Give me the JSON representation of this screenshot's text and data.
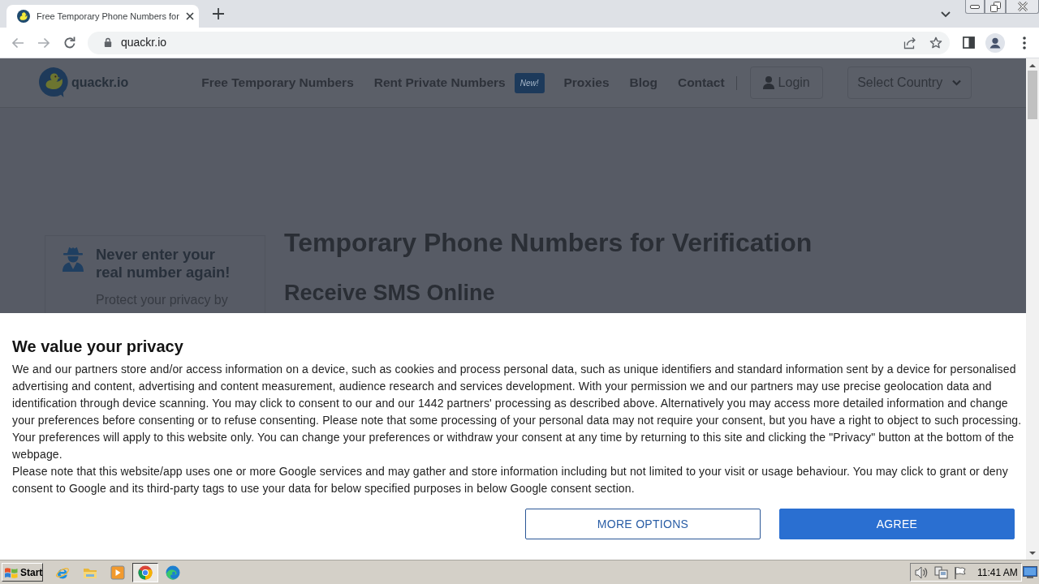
{
  "browser": {
    "tabs": [
      {
        "title": "Free Temporary Phone Numbers for",
        "selected": true
      }
    ],
    "address": "quackr.io"
  },
  "site": {
    "logo_text": "quackr.io",
    "nav": [
      {
        "label": "Free Temporary Numbers"
      },
      {
        "label": "Rent Private Numbers",
        "badge": "New!"
      },
      {
        "label": "Proxies"
      },
      {
        "label": "Blog"
      },
      {
        "label": "Contact"
      }
    ],
    "login": "Login",
    "country_select": "Select Country",
    "promo_card": {
      "title": "Never enter your real number again!",
      "text": "Protect your privacy by"
    },
    "heading": "Temporary Phone Numbers for Verification",
    "subheading": "Receive SMS Online"
  },
  "consent": {
    "title": "We value your privacy",
    "paragraphs": [
      {
        "text_before": "We and our",
        "link": "partners",
        "text_after": "store and/or access information on a device, such as cookies and process personal data, such as unique identifiers and standard information sent by a device for personalised advertising and content, advertising and content measurement, audience research and services development. With your permission we and our partners may use precise geolocation data and identification through device scanning. You may click to consent to our and our 1442 partners' processing as described above. Alternatively you may access more detailed information and change your preferences before consenting or to refuse consenting. Please note that some processing of your personal data may not require your consent, but you have a right to object to such processing. Your preferences will apply to this website only. You can change your preferences or withdraw your consent at any time by returning to this site and clicking the \"Privacy\" button at the bottom of the webpage."
      },
      {
        "text_before": "Please note that this website/app uses one or more Google services and may gather and store information including but not limited to your visit or usage behaviour. You may click to grant or deny consent to Google and its third-party tags to use your data for below specified purposes in below Google consent section."
      }
    ],
    "buttons": [
      {
        "label": "MORE OPTIONS",
        "kind": "outline"
      },
      {
        "label": "AGREE",
        "kind": "primary"
      }
    ]
  },
  "taskbar": {
    "start": "Start",
    "apps": [
      {
        "kind": "ie",
        "selected": false
      },
      {
        "kind": "folder",
        "selected": false
      },
      {
        "kind": "media",
        "selected": false
      },
      {
        "kind": "chrome",
        "selected": true
      },
      {
        "kind": "edge",
        "selected": false
      }
    ],
    "clock": "11:41 AM"
  }
}
